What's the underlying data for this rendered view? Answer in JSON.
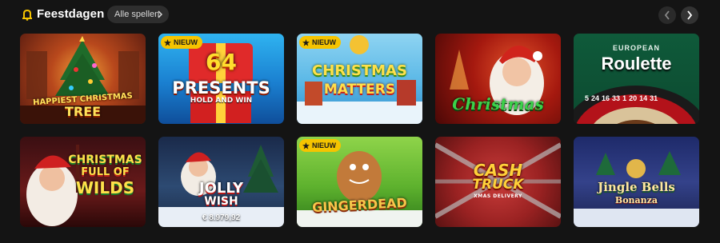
{
  "header": {
    "title": "Feestdagen",
    "all_games_label": "Alle spellen"
  },
  "badge_label": "NIEUW",
  "games": [
    {
      "title_lines": [
        "HAPPIEST CHRISTMAS",
        "TREE"
      ],
      "badge": false
    },
    {
      "title_lines": [
        "64",
        "PRESENTS",
        "HOLD AND WIN"
      ],
      "badge": true
    },
    {
      "title_lines": [
        "CHRISTMAS",
        "MATTERS"
      ],
      "badge": true
    },
    {
      "title_lines": [
        "Christmas"
      ],
      "badge": false
    },
    {
      "title_lines": [
        "EUROPEAN",
        "Roulette"
      ],
      "badge": false,
      "roulette_numbers": [
        "5",
        "24",
        "16",
        "33",
        "1",
        "20",
        "14",
        "31"
      ]
    },
    {
      "title_lines": [
        "CHRISTMAS",
        "FULL OF",
        "WILDS"
      ],
      "badge": false
    },
    {
      "title_lines": [
        "JOLLY",
        "WISH"
      ],
      "badge": false,
      "jackpot": "€ 8.979,92"
    },
    {
      "title_lines": [
        "GINGERDEAD"
      ],
      "badge": true
    },
    {
      "title_lines": [
        "CASH",
        "TRUCK",
        "XMAS DELIVERY"
      ],
      "badge": false
    },
    {
      "title_lines": [
        "Jingle Bells",
        "Bonanza"
      ],
      "badge": false
    }
  ],
  "colors": {
    "background": "#141414",
    "badge": "#f5c400",
    "button": "#2e2e2e"
  }
}
